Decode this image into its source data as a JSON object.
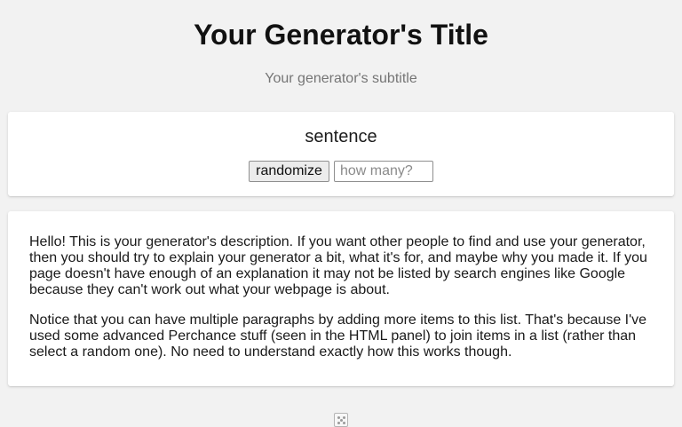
{
  "header": {
    "title": "Your Generator's Title",
    "subtitle": "Your generator's subtitle"
  },
  "output": {
    "text": "sentence",
    "randomize_label": "randomize",
    "count_placeholder": "how many?"
  },
  "description": {
    "paragraphs": [
      "Hello! This is your generator's description. If you want other people to find and use your generator, then you should try to explain your generator a bit, what it's for, and maybe why you made it. If you page doesn't have enough of an explanation it may not be listed by search engines like Google because they can't work out what your webpage is about.",
      "Notice that you can have multiple paragraphs by adding more items to this list. That's because I've used some advanced Perchance stuff (seen in the HTML panel) to join items in a list (rather than select a random one). No need to understand exactly how this works though."
    ]
  },
  "footer": {
    "icon": "dice-icon"
  }
}
